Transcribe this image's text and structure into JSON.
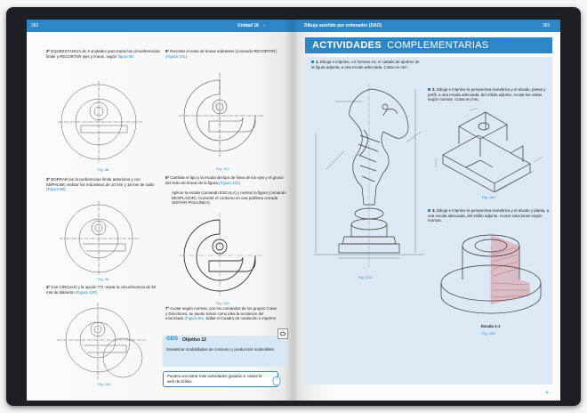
{
  "left_page": {
    "page_number": "382",
    "unit_label": "Unidad 16",
    "unit_arrow": "›",
    "steps": [
      {
        "num": "2º",
        "text": "EQUIDISTANCIA de 3 unidades para trazar las circunferencias límite y RECORTAR ejes y líneas, según",
        "ref": "figura 98."
      },
      {
        "num": "3º",
        "text": "BORRAR las circunferencias límite anteriores y con EMPALME realizar los redondeos de 10 mm y 15 mm de radio",
        "ref": "(Figura 99)."
      },
      {
        "num": "4º",
        "text": "Con CÍRCULO y la opción TTr, trazar la circunferencia de 50 mm de diámetro",
        "ref": "(Figura 100)."
      },
      {
        "num": "5º",
        "text": "Recortar el resto de líneas sobrantes (comando RECORTAR)",
        "ref": "(Figura 101)."
      },
      {
        "num": "6º",
        "text": "Cambiar el tipo y la escala del tipo de línea de los ejes y el grosor del resto de líneas de la figura",
        "ref": "(Figura 102)."
      },
      {
        "num": "",
        "text": "Aplicar la escala (comando ESCALA) y centrar la figura (comando DESPLAZAR). Convertir el contorno en una polilínea cerrada (EDITAR POLILÍNEA).",
        "ref": ""
      },
      {
        "num": "7º",
        "text": "Acotar según normas, con los comandos de los grupos Cotas y Directrices, se puede tomar como idea la acotación del enunciado",
        "ref": "(Figura 96)."
      },
      {
        "num": "",
        "text": "Editar el Cuadro de rotulación e imprimir.",
        "ref": ""
      }
    ],
    "captions": [
      "Fig. 98",
      "Fig. 99",
      "Fig. 100",
      "Fig. 101",
      "Fig. 102"
    ],
    "ods": {
      "tag": "ODS",
      "title": "Objetivo 12",
      "text": "Garantizar modalidades de consumo y producción sostenibles."
    },
    "note_text": "Puedes encontrar más actividades guiadas si visitas la web de Editex."
  },
  "right_page": {
    "page_number": "383",
    "header_title": "Dibujo asistido por ordenador (DAO)",
    "banner_bold": "ACTIVIDADES",
    "banner_light": "COMPLEMENTARIAS",
    "activities": [
      {
        "num": "1.",
        "text": "Dibuja e imprime, en formato A4, el caballo de ajedrez de la figura adjunta, a una escala adecuada. Cotas en mm."
      },
      {
        "num": "2.",
        "text": "Dibuja e imprime la perspectiva isométrica y el alzado, planta y perfil, a una escala adecuada, del sólido adjunto. Acotar las vistas según normas. Cotas en mm."
      },
      {
        "num": "3.",
        "text": "Dibuja e imprime la perspectiva isométrica y el alzado y planta, a una escala adecuada, del sólido adjunto. Acotar soluciones según normas."
      }
    ],
    "captions": [
      "Fig. 103",
      "Fig. 104",
      "Fig. 105"
    ],
    "scale_label": "Escala 1:1",
    "corner_mark": "+"
  },
  "colors": {
    "accent": "#2d86c6",
    "panel": "#dce9f4",
    "cover": "#1d1f24"
  }
}
